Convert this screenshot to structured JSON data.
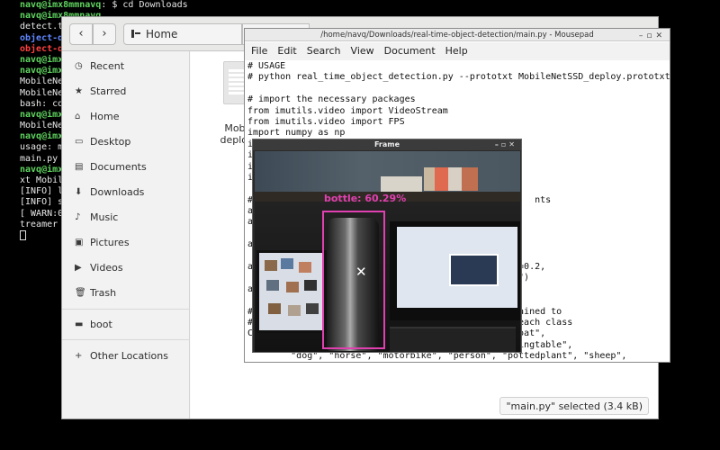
{
  "terminal": {
    "lines": [
      [
        {
          "t": "navq@imx8mmnavq",
          "c": "g"
        },
        {
          "t": ": $ cd Downloads",
          "c": ""
        }
      ],
      [
        {
          "t": "navq@imx8mmnavq",
          "c": "g"
        },
        {
          "t": "",
          "c": ""
        }
      ],
      [
        {
          "t": "detect.t",
          "c": ""
        }
      ],
      [
        {
          "t": "object-d",
          "c": "b"
        }
      ],
      [
        {
          "t": "object-d",
          "c": "r"
        }
      ],
      [
        {
          "t": "navq@imx",
          "c": "g"
        }
      ],
      [
        {
          "t": "navq@imx",
          "c": "g"
        }
      ],
      [
        {
          "t": "MobileNe",
          "c": ""
        }
      ],
      [
        {
          "t": "MobileNe",
          "c": ""
        }
      ],
      [
        {
          "t": "bash: cd",
          "c": ""
        }
      ],
      [
        {
          "t": "navq@imx",
          "c": "g"
        }
      ],
      [
        {
          "t": "MobileNe",
          "c": ""
        }
      ],
      [
        {
          "t": "navq@imx",
          "c": "g"
        }
      ],
      [
        {
          "t": "usage: m",
          "c": ""
        }
      ],
      [
        {
          "t": "main.py",
          "c": ""
        }
      ],
      [
        {
          "t": "navq@imx",
          "c": "g"
        }
      ],
      [
        {
          "t": "xt Mobil",
          "c": ""
        }
      ],
      [
        {
          "t": "[INFO] l",
          "c": ""
        }
      ],
      [
        {
          "t": "[INFO] s",
          "c": ""
        }
      ],
      [
        {
          "t": "[ WARN:0",
          "c": ""
        }
      ],
      [
        {
          "t": "treamer",
          "c": ""
        }
      ]
    ]
  },
  "files": {
    "nav_back": "‹",
    "nav_forward": "›",
    "crumb_home": "Home",
    "crumb_downloads": "Downloads",
    "sidebar": [
      {
        "label": "Recent",
        "icon": "clock-icon"
      },
      {
        "label": "Starred",
        "icon": "star-icon"
      },
      {
        "label": "Home",
        "icon": "home-icon"
      },
      {
        "label": "Desktop",
        "icon": "desktop-icon"
      },
      {
        "label": "Documents",
        "icon": "documents-icon"
      },
      {
        "label": "Downloads",
        "icon": "downloads-icon"
      },
      {
        "label": "Music",
        "icon": "music-icon"
      },
      {
        "label": "Pictures",
        "icon": "pictures-icon"
      },
      {
        "label": "Videos",
        "icon": "videos-icon"
      },
      {
        "label": "Trash",
        "icon": "trash-icon"
      },
      {
        "label": "boot",
        "icon": "drive-icon"
      },
      {
        "label": "Other Locations",
        "icon": "plus-icon"
      }
    ],
    "file_name_line1": "Mobil",
    "file_name_line2": "deploy.",
    "status": "\"main.py\" selected (3.4 kB)"
  },
  "mousepad": {
    "title": "/home/navq/Downloads/real-time-object-detection/main.py - Mousepad",
    "menu": [
      "File",
      "Edit",
      "Search",
      "View",
      "Document",
      "Help"
    ],
    "code": [
      "# USAGE",
      "# python real_time_object_detection.py --prototxt MobileNetSSD_deploy.prototxt.t",
      "",
      "# import the necessary packages",
      "from imutils.video import VideoStream",
      "from imutils.video import FPS",
      "import numpy as np",
      "i",
      "i",
      "i",
      "i",
      "",
      "#                                                    nts",
      "a",
      "a",
      "",
      "a",
      "",
      "a                                          default=0.2,",
      "                                           ections\")",
      "a",
      "",
      "#                                           was trained to",
      "#                                           s for each class",
      "C                                          rd\", \"boat\",",
      "                                           \", \"diningtable\",",
      "        \"dog\", \"horse\", \"motorbike\", \"person\", \"pottedplant\", \"sheep\","
    ]
  },
  "frame": {
    "title": "Frame",
    "detection_label": "bottle: 60.29%"
  }
}
